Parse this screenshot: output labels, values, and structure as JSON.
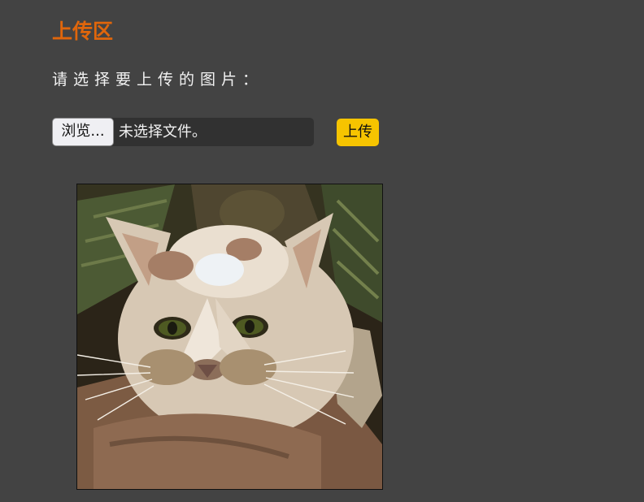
{
  "header": {
    "title": "上传区"
  },
  "form": {
    "prompt": "请选择要上传的图片：",
    "browse_label": "浏览...",
    "file_status": "未选择文件。",
    "upload_label": "上传"
  },
  "colors": {
    "background": "#434343",
    "title": "#e0660b",
    "text": "#f2f2f2",
    "upload_button": "#f6c400",
    "file_field_bg": "#313131"
  },
  "preview": {
    "icon": "cat-photo-icon"
  }
}
